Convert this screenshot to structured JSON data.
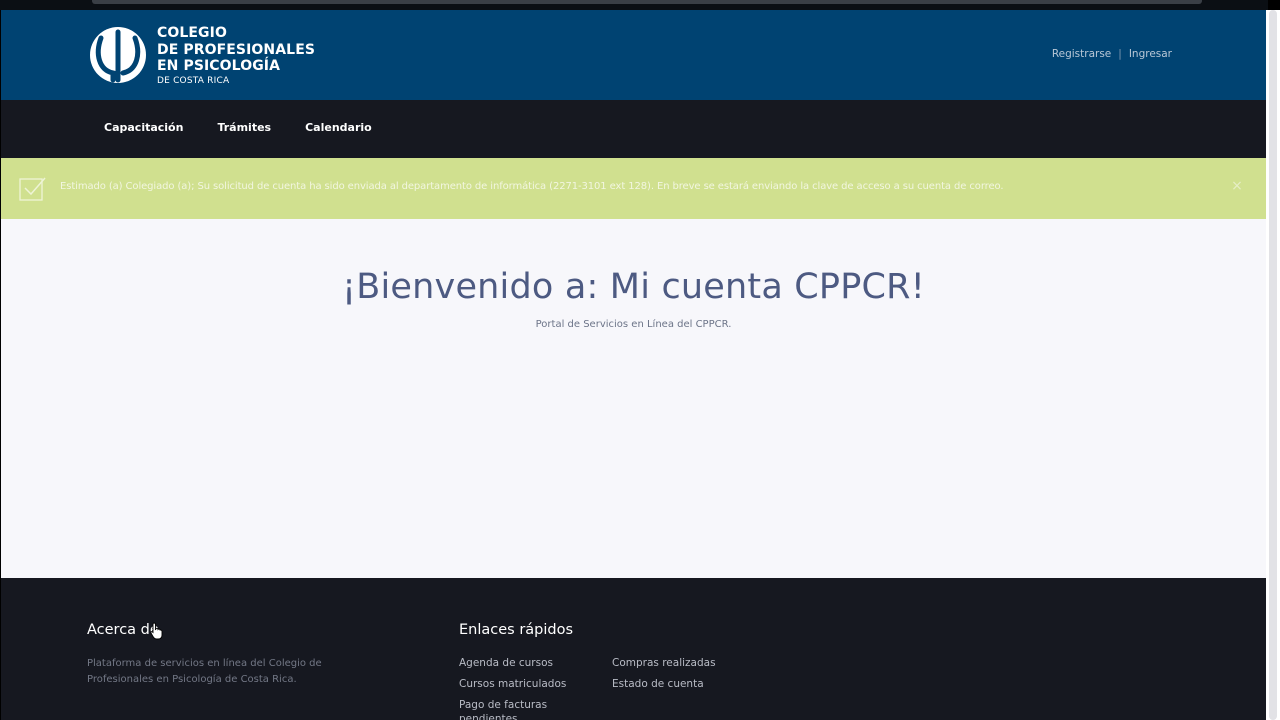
{
  "header": {
    "logo_lines": [
      "COLEGIO",
      "DE PROFESIONALES",
      "EN PSICOLOGÍA"
    ],
    "logo_sub": "DE COSTA RICA",
    "register_label": "Registrarse",
    "separator": "|",
    "login_label": "Ingresar"
  },
  "nav": {
    "items": [
      {
        "label": "Capacitación"
      },
      {
        "label": "Trámites"
      },
      {
        "label": "Calendario"
      }
    ]
  },
  "alert": {
    "icon": "check-square-icon",
    "message": "Estimado (a) Colegiado (a); Su solicitud de cuenta ha sido enviada al departamento de informática (2271-3101 ext 128). En breve se estará enviando la clave de acceso a su cuenta de correo.",
    "close_symbol": "×",
    "color": "#d0e08f"
  },
  "main": {
    "title": "¡Bienvenido a: Mi cuenta CPPCR!",
    "subtitle": "Portal de Servicios en Línea del CPPCR."
  },
  "footer": {
    "about_heading": "Acerca de",
    "about_text": "Plataforma de servicios en línea del Colegio de Profesionales en Psicología de Costa Rica.",
    "links_heading": "Enlaces rápidos",
    "links_col1": [
      "Agenda de cursos",
      "Cursos matriculados",
      "Pago de facturas pendientes"
    ],
    "links_col2": [
      "Compras realizadas",
      "Estado de cuenta"
    ]
  },
  "colors": {
    "header_bg": "#004372",
    "nav_bg": "#161820",
    "title": "#4d5a82"
  }
}
